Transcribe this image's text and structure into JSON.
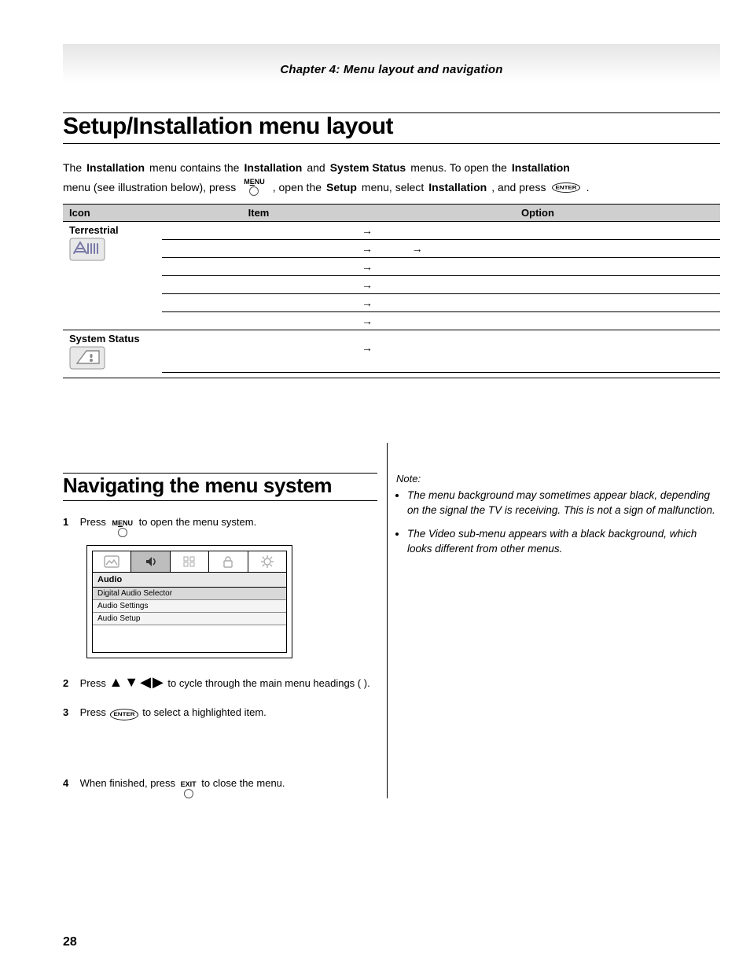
{
  "chapter_banner": "Chapter 4: Menu layout and navigation",
  "h1": "Setup/Installation menu layout",
  "intro": {
    "seg1": "The ",
    "installation1": "Installation",
    "seg2": " menu contains the ",
    "installation2": "Installation",
    "seg3": " and ",
    "sysstatus": "System Status",
    "seg4": " menus. To open the ",
    "installation3": "Installation",
    "seg5": " menu (see illustration below), press ",
    "menu_lbl_pre": "M",
    "menu_lbl_u": "E",
    "menu_lbl_post": "NU",
    "seg6": ", open the ",
    "setup": "Setup",
    "seg7": " menu, select ",
    "installation4": "Installation",
    "seg8": ", and press ",
    "enter": "ENTER",
    "seg9": "."
  },
  "thead": {
    "c1": "Icon",
    "c2": "Item",
    "c3": "Option"
  },
  "rows": {
    "terrestrial": "Terrestrial",
    "sysstatus": "System Status"
  },
  "arrow": "→",
  "h2": "Navigating the menu system",
  "nav": {
    "s1a": "1",
    "s1b": "Press ",
    "s1c": " to open the menu system.",
    "mock_title": "Audio",
    "mock_items": [
      "Digital Audio Selector",
      "Audio Settings",
      "Audio Setup"
    ],
    "s2a": "2",
    "s2b": "Press ",
    "s2c": " to cycle through the main menu headings (",
    "dpad": "▲▼◀▶",
    "s2d": ").",
    "s3a": "3",
    "s3b": "Press ",
    "s3c": " to select a highlighted item.",
    "s4a": "4",
    "s4b": "When finished, press ",
    "exit": "EXIT",
    "s4c": " to close the menu."
  },
  "notes_hdr": "Note:",
  "notes": [
    "The menu background may sometimes appear black, depending on the signal the TV is receiving. This is not a sign of malfunction.",
    "The Video sub-menu appears with a black background, which looks different from other menus."
  ],
  "pagenum": "28"
}
